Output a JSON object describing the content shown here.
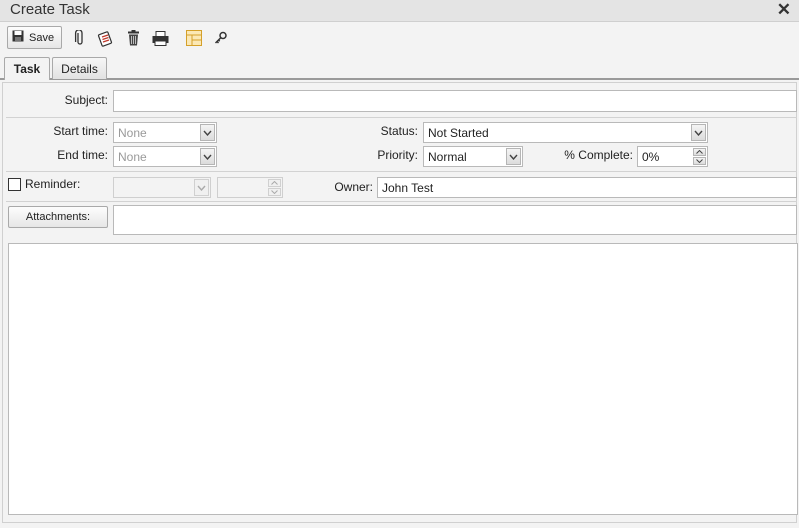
{
  "window": {
    "title": "Create Task",
    "close_glyph": "✕"
  },
  "toolbar": {
    "save_label": "Save",
    "icons": [
      "save-icon",
      "attach-icon",
      "flag-icon",
      "delete-icon",
      "print-icon",
      "layout-icon",
      "key-icon"
    ]
  },
  "tabs": [
    {
      "label": "Task",
      "active": true
    },
    {
      "label": "Details",
      "active": false
    }
  ],
  "form": {
    "subject": {
      "label": "Subject:",
      "value": ""
    },
    "start_time": {
      "label": "Start time:",
      "value": "None"
    },
    "end_time": {
      "label": "End time:",
      "value": "None"
    },
    "status": {
      "label": "Status:",
      "value": "Not Started"
    },
    "priority": {
      "label": "Priority:",
      "value": "Normal"
    },
    "percent_complete": {
      "label": "% Complete:",
      "value": "0%"
    },
    "reminder": {
      "label": "Reminder:",
      "checked": false,
      "date_value": "",
      "time_value": ""
    },
    "owner": {
      "label": "Owner:",
      "value": "John Test"
    },
    "attachments": {
      "button_label": "Attachments:",
      "value": ""
    },
    "notes": ""
  },
  "colors": {
    "accent_icon": "#d4a02a",
    "background": "#f3f3f3"
  }
}
